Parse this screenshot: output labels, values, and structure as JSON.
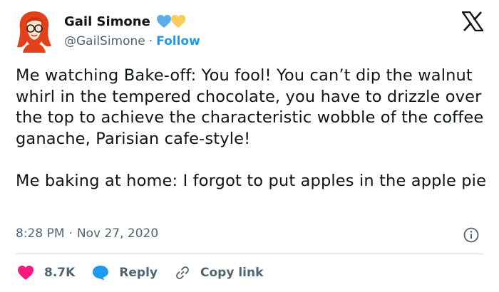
{
  "author": {
    "name": "Gail Simone",
    "handle": "@GailSimone",
    "separator": "·",
    "follow_label": "Follow",
    "badges": [
      "blue-heart-icon",
      "yellow-heart-icon"
    ]
  },
  "tweet": {
    "paragraphs": [
      "Me watching Bake-off: You fool!  You can’t dip the walnut whirl in the tempered chocolate, you have to drizzle over the top to achieve the characteristic wobble of the coffee ganache, Parisian cafe-style!",
      "Me baking at home:  I forgot to put apples in the apple pie"
    ],
    "time": "8:28 PM",
    "dot": "·",
    "date": "Nov 27, 2020"
  },
  "actions": {
    "like_count": "8.7K",
    "reply_label": "Reply",
    "copy_label": "Copy link"
  },
  "colors": {
    "accent": "#1d9bf0",
    "like": "#f91880",
    "muted": "#536471",
    "text": "#0f1419"
  }
}
